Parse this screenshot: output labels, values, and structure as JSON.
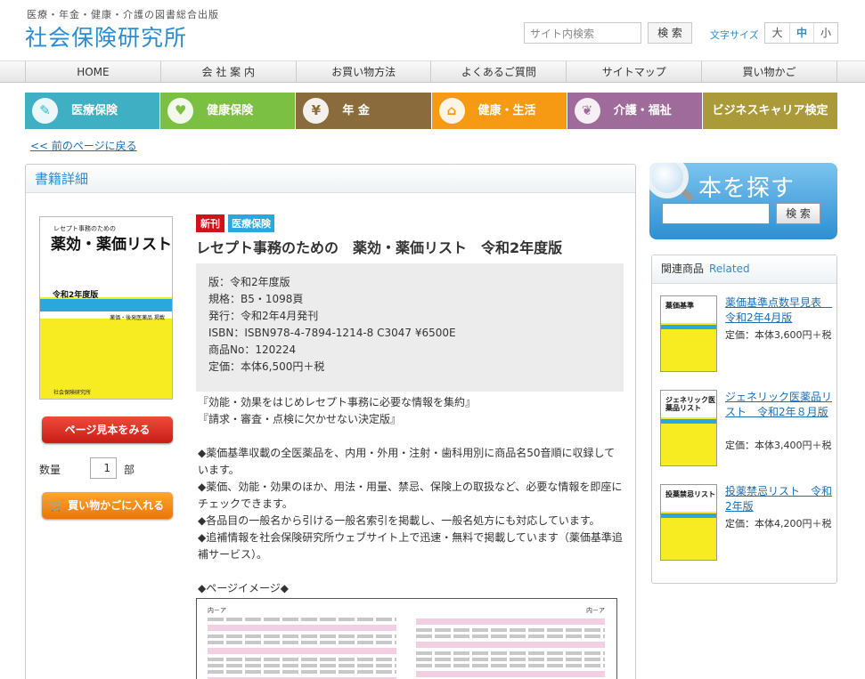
{
  "header": {
    "tagline": "医療・年金・健康・介護の図書総合出版",
    "logo": "社会保険研究所",
    "search_placeholder": "サイト内検索",
    "search_button": "検 索",
    "font_size_label": "文字サイズ",
    "font_sizes": [
      "大",
      "中",
      "小"
    ]
  },
  "global_nav": [
    "HOME",
    "会 社 案 内",
    "お買い物方法",
    "よくあるご質問",
    "サイトマップ",
    "買い物かご"
  ],
  "category_nav": [
    {
      "label": "医療保険",
      "icon": "syringe-icon",
      "glyph": "✎",
      "color": "#3fb0c3"
    },
    {
      "label": "健康保険",
      "icon": "heart-icon",
      "glyph": "♥",
      "color": "#7cc043"
    },
    {
      "label": "年 金",
      "icon": "yen-icon",
      "glyph": "¥",
      "color": "#8a6b3b"
    },
    {
      "label": "健康・生活",
      "icon": "home-icon",
      "glyph": "⌂",
      "color": "#f59a12"
    },
    {
      "label": "介護・福祉",
      "icon": "leaf-icon",
      "glyph": "❦",
      "color": "#9e6b9a"
    },
    {
      "label": "ビジネスキャリア検定",
      "icon": "",
      "glyph": "",
      "color": "#aa9a39"
    }
  ],
  "back_link": "<< 前のページに戻る",
  "detail": {
    "heading": "書籍詳細",
    "cover_small": "レセプト事務のための",
    "cover_big": "薬効・薬価リスト",
    "cover_year": "令和2年度版",
    "cover_sub": "薬価・後発医薬品 掲載",
    "cover_publisher": "社会保険研究所",
    "preview_button": "ページ見本をみる",
    "qty_label": "数量",
    "qty_value": "1",
    "qty_unit": "部",
    "cart_button": "買い物かごに入れる",
    "badge_new": "新刊",
    "badge_category": "医療保険",
    "title": "レセプト事務のための　薬効・薬価リスト　令和2年度版",
    "specs": [
      "版：令和2年度版",
      "規格：B5・1098頁",
      "発行：令和2年4月発刊",
      "ISBN：ISBN978-4-7894-1214-8 C3047 ¥6500E",
      "商品No：120224",
      "定価：本体6,500円＋税"
    ],
    "description": [
      "『効能・効果をはじめレセプト事務に必要な情報を集約』",
      "『請求・審査・点検に欠かせない決定版』",
      "",
      "◆薬価基準収載の全医薬品を、内用・外用・注射・歯科用別に商品名50音順に収録しています。",
      "◆薬価、効能・効果のほか、用法・用量、禁忌、保険上の取扱など、必要な情報を即座にチェックできます。",
      "◆各品目の一般名から引ける一般名索引を掲載し、一般名処方にも対応しています。",
      "◆追補情報を社会保険研究所ウェブサイト上で迅速・無料で掲載しています（薬価基準追補サービス）。",
      "",
      "◆ページイメージ◆"
    ],
    "preview_page_left": "内－ア",
    "preview_page_right": "内－ア"
  },
  "sidebar": {
    "find_title": "本を探す",
    "find_button": "検 索",
    "related_heading": "関連商品",
    "related_sub": "Related",
    "related": [
      {
        "cover_title": "薬価基準",
        "name": "薬価基準点数早見表　令和2年4月版",
        "price": "定価：本体3,600円＋税"
      },
      {
        "cover_title": "ジェネリック医薬品リスト",
        "name": "ジェネリック医薬品リスト　令和2年８月版",
        "price": "定価：本体3,400円＋税"
      },
      {
        "cover_title": "投薬禁忌リスト",
        "name": "投薬禁忌リスト　令和2年版",
        "price": "定価：本体4,200円＋税"
      }
    ]
  }
}
